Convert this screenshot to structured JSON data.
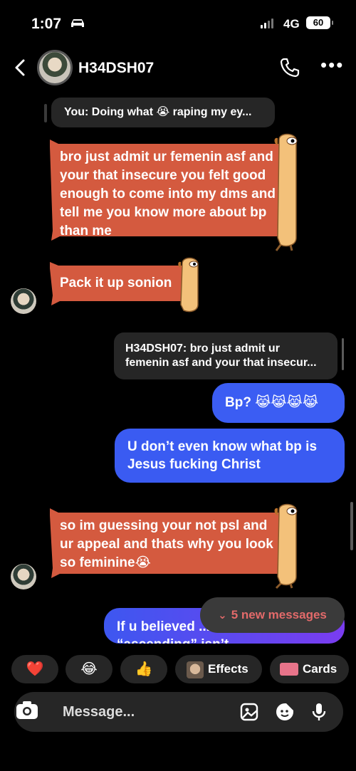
{
  "status_bar": {
    "time": "1:07",
    "network": "4G",
    "battery": "60"
  },
  "header": {
    "contact_name": "H34DSH07"
  },
  "messages": [
    {
      "kind": "reply_preview",
      "text": "You: Doing what 😭 raping my ey..."
    },
    {
      "kind": "incoming",
      "text": "bro just admit ur femenin asf and your that insecure you felt good enough to come into my dms and tell me you know more about bp than me"
    },
    {
      "kind": "incoming",
      "text": "Pack it up sonion"
    },
    {
      "kind": "reply_preview",
      "text": "H34DSH07: bro just admit ur femenin asf and your that insecur..."
    },
    {
      "kind": "outgoing",
      "text": "Bp? 😹😹😹😹"
    },
    {
      "kind": "outgoing",
      "text": "U don’t even know what bp is Jesus fucking Christ"
    },
    {
      "kind": "incoming",
      "text": "so im guessing your not psl and ur appeal and thats why you look so feminine😭"
    },
    {
      "kind": "outgoing",
      "text": "If u believed ... believe “ascending” isn’t"
    }
  ],
  "new_messages": "5 new messages",
  "quick_reactions": [
    {
      "label": "❤️"
    },
    {
      "label": "😂"
    },
    {
      "label": "👍"
    },
    {
      "label": "Effects"
    },
    {
      "label": "Cards"
    }
  ],
  "composer": {
    "placeholder": "Message..."
  },
  "colors": {
    "incoming_scroll": "#d45a3f",
    "outgoing_blue": "#3a5ef5",
    "outgoing_purple": "#7a3cf0",
    "background": "#000000"
  },
  "icons": [
    "back-chevron-icon",
    "phone-icon",
    "more-dots-icon",
    "camera-icon",
    "gallery-icon",
    "sticker-icon",
    "microphone-icon",
    "double-chevron-down-icon"
  ]
}
